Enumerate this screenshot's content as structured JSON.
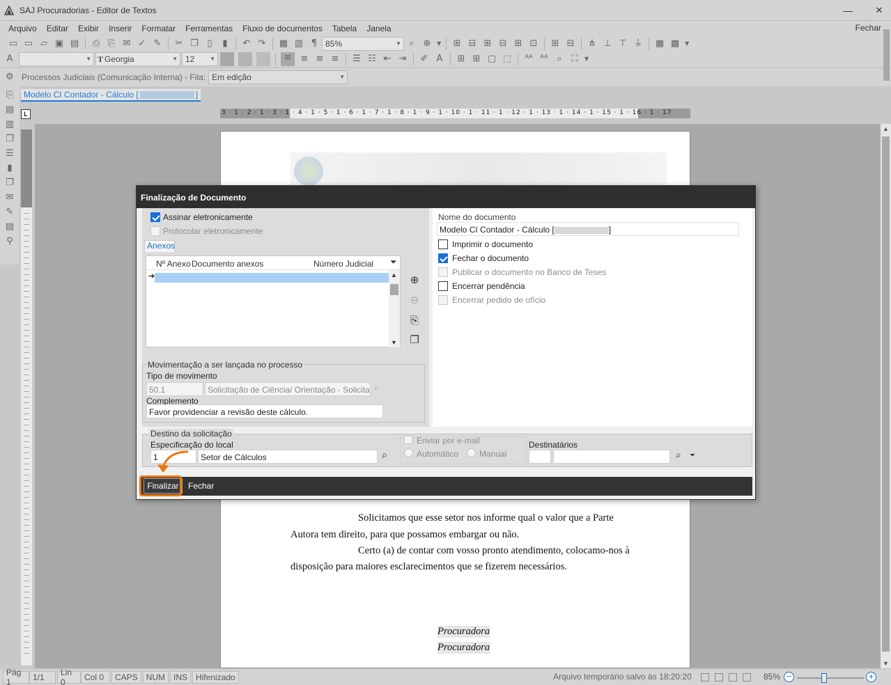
{
  "window": {
    "title": "SAJ Procuradorias - Editor de Textos",
    "minimize": "—",
    "close": "✕"
  },
  "menu": [
    "Arquivo",
    "Editar",
    "Exibir",
    "Inserir",
    "Formatar",
    "Ferramentas",
    "Fluxo de documentos",
    "Tabela",
    "Janela"
  ],
  "menu_close": "Fechar",
  "format": {
    "font": "Georgia",
    "size": "12",
    "zoom": "85%"
  },
  "process": {
    "label": "Processos Judiciais (Comunicação Interna) - Fila:",
    "queue": "Em edição"
  },
  "doc_tab": {
    "prefix": "Modelo CI Contador - Cálculo [",
    "suffix": "]"
  },
  "ruler": {
    "corner": "L",
    "numbers": "3 · 1 · 2 · 1 · 3 · 1 · 4 · 1 · 5 · 1 · 6 · 1 · 7 · 1 · 8 · 1 · 9 · 1 · 10 · 1 · 11 · 1 · 12 · 1 · 13 · 1 · 14 · 1 · 15 · 1 · 16 · 1 · 17"
  },
  "page_text": {
    "p1": "Solicitamos que esse setor nos informe qual o valor que a Parte",
    "p1b": "Autora tem direito, para que possamos embargar ou não.",
    "p2": "Certo (a) de contar com vosso pronto atendimento, colocamo-nos à",
    "p2b": "disposição para maiores esclarecimentos que se fizerem necessários.",
    "sig1": "Procuradora",
    "sig2": "Procuradora"
  },
  "dialog": {
    "title": "Finalização de Documento",
    "assinar": "Assinar eletronicamente",
    "protocolar": "Protocolar eletronicamente",
    "tab_anexos": "Anexos",
    "grid_headers": [
      "Nº Anexo",
      "Documento anexos",
      "Número Judicial"
    ],
    "mov_legend": "Movimentação a ser lançada no processo",
    "tipo_label": "Tipo de movimento",
    "tipo_code": "50.1",
    "tipo_desc": "Solicitação de Ciência/ Orientação - Solicitaçã",
    "complemento_label": "Complemento",
    "complemento_value": "Favor providenciar a revisão deste cálculo.",
    "destino_legend": "Destino da solicitação",
    "especificacao_label": "Especificação do local",
    "local_code": "1",
    "local_name": "Setor de Cálculos",
    "enviar_email": "Enviar por e-mail",
    "automatico": "Automático",
    "manual": "Manual",
    "destinatarios": "Destinatários",
    "nome_label": "Nome do documento",
    "nome_prefix": "Modelo CI Contador - Cálculo [",
    "nome_suffix": "]",
    "imprimir": "Imprimir o documento",
    "fechar_doc": "Fechar o documento",
    "publicar": "Publicar o documento no Banco de Teses",
    "encerrar_pend": "Encerrar pendência",
    "encerrar_oficio": "Encerrar pedido de ofício",
    "btn_finalizar": "Finalizar",
    "btn_fechar": "Fechar"
  },
  "status": {
    "pag": "Pág 1",
    "of": "1/1",
    "linha": "Lin 0",
    "col": "Col 0",
    "caps": "CAPS",
    "num": "NUM",
    "ins": "INS",
    "hifen": "Hifenizado",
    "saved": "Arquivo temporário salvo às 18:20:20",
    "zoom": "85%"
  },
  "colors": {
    "accent": "#1a6ed8",
    "highlight": "#e8780e",
    "dialog_header": "#2f2f2f"
  }
}
